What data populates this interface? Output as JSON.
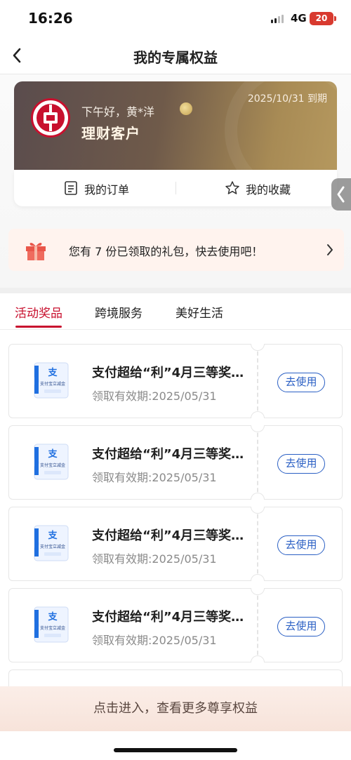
{
  "status_bar": {
    "time": "16:26",
    "network": "4G",
    "battery": "20"
  },
  "nav": {
    "title": "我的专属权益"
  },
  "member_card": {
    "greeting": "下午好，黄*洋",
    "customer_type": "理财客户",
    "expiry": "2025/10/31 到期"
  },
  "quick_actions": [
    {
      "label": "我的订单",
      "icon": "order-list-icon"
    },
    {
      "label": "我的收藏",
      "icon": "star-outline-icon"
    }
  ],
  "gift_banner": {
    "text": "您有 7 份已领取的礼包，快去使用吧！"
  },
  "tabs": [
    {
      "label": "活动奖品",
      "active": true
    },
    {
      "label": "跨境服务",
      "active": false
    },
    {
      "label": "美好生活",
      "active": false
    }
  ],
  "coupons": [
    {
      "title": "支付超给“利”4月三等奖…",
      "valid": "领取有效期:2025/05/31",
      "action": "去使用",
      "thumb_text": "支付宝立减金"
    },
    {
      "title": "支付超给“利”4月三等奖…",
      "valid": "领取有效期:2025/05/31",
      "action": "去使用",
      "thumb_text": "支付宝立减金"
    },
    {
      "title": "支付超给“利”4月三等奖…",
      "valid": "领取有效期:2025/05/31",
      "action": "去使用",
      "thumb_text": "支付宝立减金"
    },
    {
      "title": "支付超给“利”4月三等奖…",
      "valid": "领取有效期:2025/05/31",
      "action": "去使用",
      "thumb_text": "支付宝立减金"
    }
  ],
  "bottom_cta": {
    "text": "点击进入，查看更多尊享权益"
  },
  "colors": {
    "brand_red": "#c8102e",
    "link_blue": "#2a5fc4",
    "card_gold": "#b5985e"
  }
}
